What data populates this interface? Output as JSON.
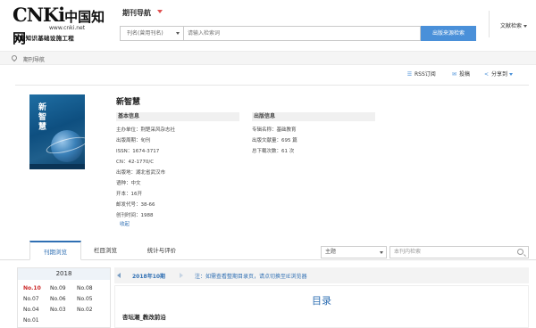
{
  "brand": {
    "logo_main": "CNKi",
    "logo_cn": "中国知网",
    "url": "www.cnki.net",
    "subtitle": "中国知识基础设施工程"
  },
  "nav": {
    "title": "期刊导航"
  },
  "search": {
    "field_label": "刊名(曾用刊名)",
    "placeholder": "请输入检索词",
    "button": "出版来源检索",
    "doc_search": "文献检索"
  },
  "breadcrumb": {
    "text": "期刊导航"
  },
  "toolbar": {
    "rss": "RSS订阅",
    "submit": "投稿",
    "share": "分享到"
  },
  "journal": {
    "cover_title": "新智慧",
    "title": "新智慧",
    "basic_info_heading": "基本信息",
    "basic_info": [
      "主办单位：荆楚采风杂志社",
      "出版周期：旬刊",
      "ISSN：1674-3717",
      "CN：42-1770/C",
      "出版地：湖北省武汉市",
      "语种：中文",
      "开本：16开",
      "邮发代号：38-66",
      "创刊时间：1988"
    ],
    "collapse": "收起",
    "pub_info_heading": "出版信息",
    "pub_info": [
      "专辑名称：基础教育",
      "出版文献量：695 篇",
      "总下载次数：61 次"
    ]
  },
  "tabs": {
    "items": [
      "刊期浏览",
      "栏目浏览",
      "统计与评价"
    ],
    "active_index": 0
  },
  "filter": {
    "topic_label": "主题",
    "inner_search_placeholder": "本刊内检索"
  },
  "years": {
    "year": "2018",
    "issues": [
      "No.10",
      "No.09",
      "No.08",
      "No.07",
      "No.06",
      "No.05",
      "No.04",
      "No.03",
      "No.02",
      "No.01"
    ],
    "selected": "No.10"
  },
  "contents": {
    "current_issue": "2018年10期",
    "note": "注：如需查看整期目录页，请点切换至IE浏览器",
    "toc_title": "目录",
    "column": "杏坛潮_教改前沿"
  },
  "colors": {
    "accent": "#2f6fb3",
    "button": "#4a90d9",
    "selected_issue": "#cc2a2a",
    "cover": "#0e4f80"
  }
}
